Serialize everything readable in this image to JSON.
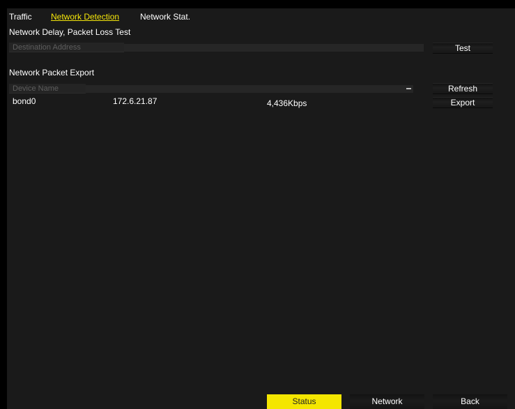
{
  "tabs": [
    {
      "label": "Traffic",
      "active": false
    },
    {
      "label": "Network Detection",
      "active": true
    },
    {
      "label": "Network Stat.",
      "active": false
    }
  ],
  "delay_test": {
    "title": "Network Delay, Packet Loss Test",
    "destination_placeholder": "Destination Address",
    "destination_value": "",
    "test_label": "Test"
  },
  "packet_export": {
    "title": "Network Packet Export",
    "device_select_label": "Device Name",
    "refresh_label": "Refresh",
    "export_label": "Export",
    "device": {
      "name": "bond0",
      "ip": "172.6.21.87",
      "rate": "4,436Kbps"
    }
  },
  "footer": {
    "status_label": "Status",
    "network_label": "Network",
    "back_label": "Back",
    "active": "status"
  },
  "colors": {
    "accent": "#f4e600",
    "background": "#1a1a1a",
    "text": "#ffffff",
    "placeholder": "#5e5e5e"
  }
}
